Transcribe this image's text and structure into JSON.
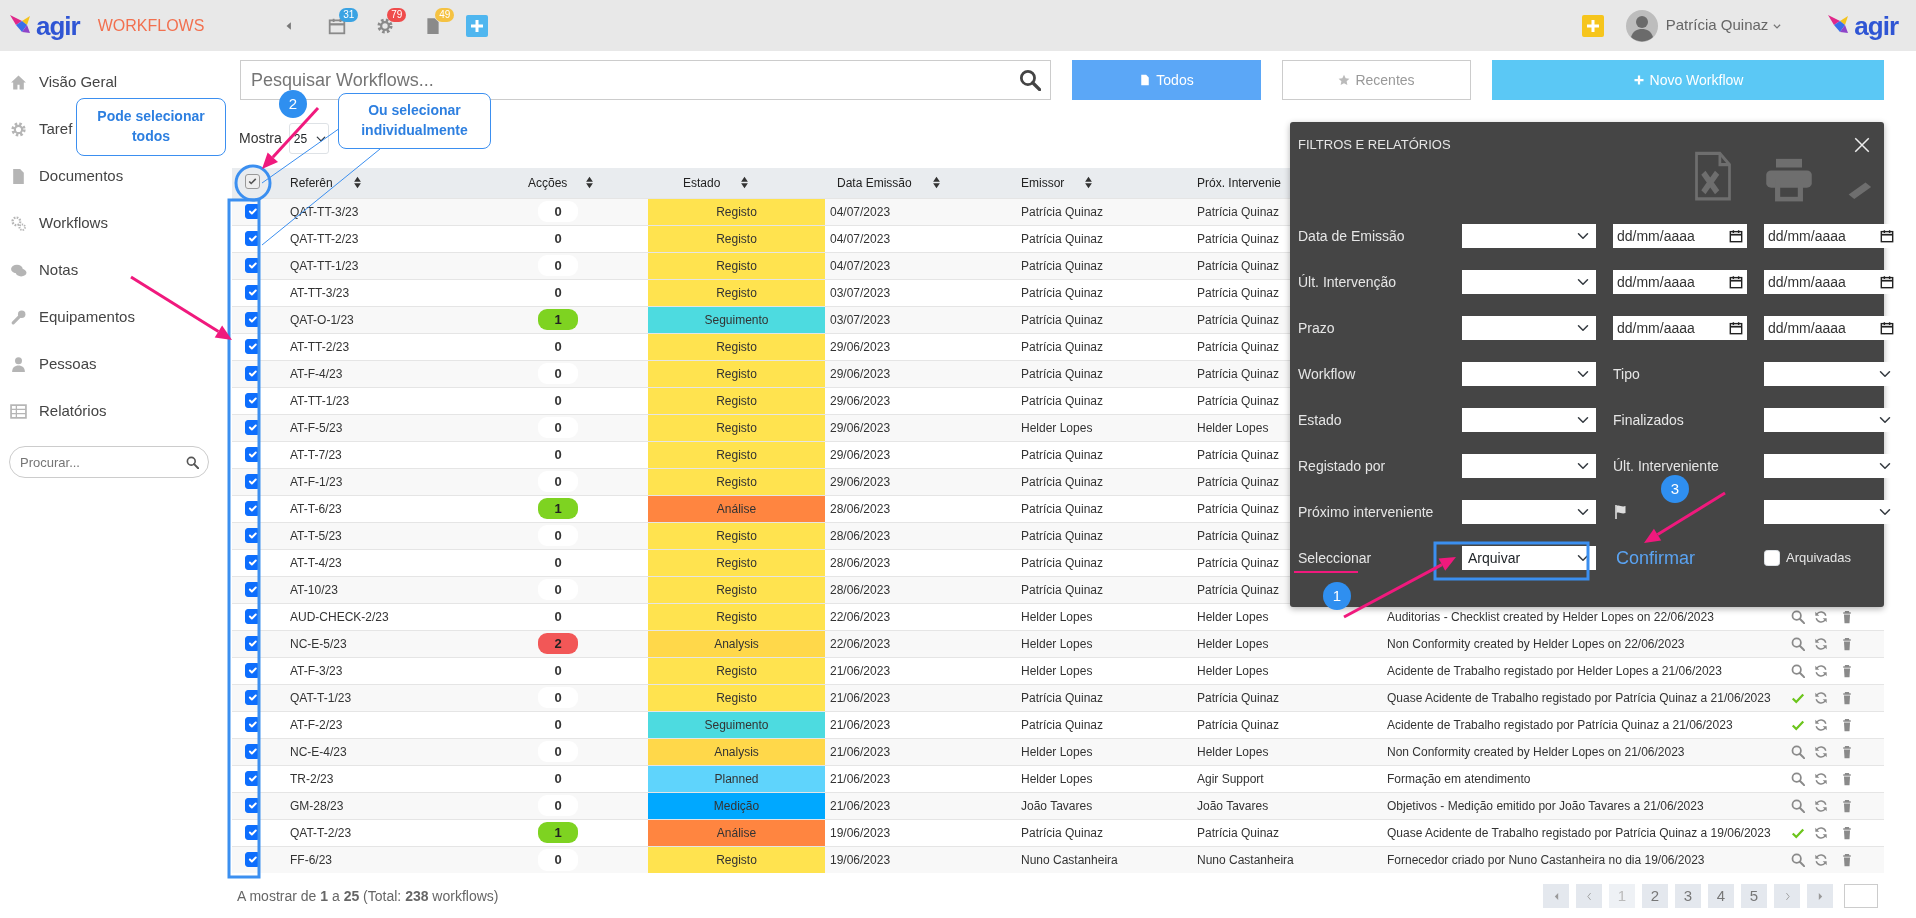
{
  "header": {
    "logo": "agir",
    "module": "WORKFLOWS",
    "notifications": [
      {
        "kind": "calendar",
        "count": "31",
        "color": "#3aa3e3"
      },
      {
        "kind": "gear",
        "count": "79",
        "color": "#ef4b4b"
      },
      {
        "kind": "document",
        "count": "49",
        "color": "#f5c242"
      }
    ],
    "user": {
      "name": "Patrícia Quinaz"
    },
    "logo_right": "agir"
  },
  "sidebar": {
    "items": [
      {
        "kind": "home",
        "label": "Visão Geral"
      },
      {
        "kind": "gear",
        "label": "Taref"
      },
      {
        "kind": "document",
        "label": "Documentos"
      },
      {
        "kind": "gears",
        "label": "Workflows"
      },
      {
        "kind": "chat",
        "label": "Notas"
      },
      {
        "kind": "wrench",
        "label": "Equipamentos"
      },
      {
        "kind": "person",
        "label": "Pessoas"
      },
      {
        "kind": "table",
        "label": "Relatórios"
      }
    ],
    "search": {
      "placeholder": "Procurar..."
    }
  },
  "toolbar": {
    "search": {
      "placeholder": "Pesquisar Workflows..."
    },
    "buttons": [
      {
        "kind": "document",
        "label": "Todos",
        "selected": true
      },
      {
        "kind": "star",
        "label": "Recentes",
        "selected": false
      },
      {
        "kind": "new",
        "label": "Novo Workflow"
      }
    ]
  },
  "page_size": {
    "label": "Mostra",
    "value": "25"
  },
  "table": {
    "select_all": {
      "checked": true
    },
    "columns": [
      {
        "label": "Referên",
        "sortable": true
      },
      {
        "label": "Acções",
        "sortable": true
      },
      {
        "label": "Estado",
        "sortable": true
      },
      {
        "label": "Data Emissão",
        "sortable": true
      },
      {
        "label": "Emissor",
        "sortable": true
      },
      {
        "label": "Próx. Intervenie",
        "sortable": false
      }
    ],
    "rows": [
      {
        "checked": true,
        "reference": "QAT-TT-3/23",
        "actions": {
          "count": "0"
        },
        "state": {
          "label": "Registo",
          "color": "#ffe34f"
        },
        "date": "04/07/2023",
        "issuer": "Patrícia Quinaz",
        "next": "Patrícia Quinaz"
      },
      {
        "checked": true,
        "reference": "QAT-TT-2/23",
        "actions": {
          "count": "0"
        },
        "state": {
          "label": "Registo",
          "color": "#ffe34f"
        },
        "date": "04/07/2023",
        "issuer": "Patrícia Quinaz",
        "next": "Patrícia Quinaz"
      },
      {
        "checked": true,
        "reference": "QAT-TT-1/23",
        "actions": {
          "count": "0"
        },
        "state": {
          "label": "Registo",
          "color": "#ffe34f"
        },
        "date": "04/07/2023",
        "issuer": "Patrícia Quinaz",
        "next": "Patrícia Quinaz"
      },
      {
        "checked": true,
        "reference": "AT-TT-3/23",
        "actions": {
          "count": "0"
        },
        "state": {
          "label": "Registo",
          "color": "#ffe34f"
        },
        "date": "03/07/2023",
        "issuer": "Patrícia Quinaz",
        "next": "Patrícia Quinaz"
      },
      {
        "checked": true,
        "reference": "QAT-O-1/23",
        "actions": {
          "count": "1",
          "color": "#7ed321"
        },
        "state": {
          "label": "Seguimento",
          "color": "#4ddbe0"
        },
        "date": "03/07/2023",
        "issuer": "Patrícia Quinaz",
        "next": "Patrícia Quinaz"
      },
      {
        "checked": true,
        "reference": "AT-TT-2/23",
        "actions": {
          "count": "0"
        },
        "state": {
          "label": "Registo",
          "color": "#ffe34f"
        },
        "date": "29/06/2023",
        "issuer": "Patrícia Quinaz",
        "next": "Patrícia Quinaz"
      },
      {
        "checked": true,
        "reference": "AT-F-4/23",
        "actions": {
          "count": "0"
        },
        "state": {
          "label": "Registo",
          "color": "#ffe34f"
        },
        "date": "29/06/2023",
        "issuer": "Patrícia Quinaz",
        "next": "Patrícia Quinaz"
      },
      {
        "checked": true,
        "reference": "AT-TT-1/23",
        "actions": {
          "count": "0"
        },
        "state": {
          "label": "Registo",
          "color": "#ffe34f"
        },
        "date": "29/06/2023",
        "issuer": "Patrícia Quinaz",
        "next": "Patrícia Quinaz"
      },
      {
        "checked": true,
        "reference": "AT-F-5/23",
        "actions": {
          "count": "0"
        },
        "state": {
          "label": "Registo",
          "color": "#ffe34f"
        },
        "date": "29/06/2023",
        "issuer": "Helder Lopes",
        "next": "Helder Lopes"
      },
      {
        "checked": true,
        "reference": "AT-T-7/23",
        "actions": {
          "count": "0"
        },
        "state": {
          "label": "Registo",
          "color": "#ffe34f"
        },
        "date": "29/06/2023",
        "issuer": "Patrícia Quinaz",
        "next": "Patrícia Quinaz"
      },
      {
        "checked": true,
        "reference": "AT-F-1/23",
        "actions": {
          "count": "0"
        },
        "state": {
          "label": "Registo",
          "color": "#ffe34f"
        },
        "date": "29/06/2023",
        "issuer": "Patrícia Quinaz",
        "next": "Patrícia Quinaz"
      },
      {
        "checked": true,
        "reference": "AT-T-6/23",
        "actions": {
          "count": "1",
          "color": "#7ed321"
        },
        "state": {
          "label": "Análise",
          "color": "#ff8540"
        },
        "date": "28/06/2023",
        "issuer": "Patrícia Quinaz",
        "next": "Patrícia Quinaz"
      },
      {
        "checked": true,
        "reference": "AT-T-5/23",
        "actions": {
          "count": "0"
        },
        "state": {
          "label": "Registo",
          "color": "#ffe34f"
        },
        "date": "28/06/2023",
        "issuer": "Patrícia Quinaz",
        "next": "Patrícia Quinaz"
      },
      {
        "checked": true,
        "reference": "AT-T-4/23",
        "actions": {
          "count": "0"
        },
        "state": {
          "label": "Registo",
          "color": "#ffe34f"
        },
        "date": "28/06/2023",
        "issuer": "Patrícia Quinaz",
        "next": "Patrícia Quinaz"
      },
      {
        "checked": true,
        "reference": "AT-10/23",
        "actions": {
          "count": "0"
        },
        "state": {
          "label": "Registo",
          "color": "#ffe34f"
        },
        "date": "28/06/2023",
        "issuer": "Patrícia Quinaz",
        "next": "Patrícia Quinaz"
      },
      {
        "checked": true,
        "reference": "AUD-CHECK-2/23",
        "actions": {
          "count": "0"
        },
        "state": {
          "label": "Registo",
          "color": "#ffe34f"
        },
        "date": "22/06/2023",
        "issuer": "Helder Lopes",
        "next": "Helder Lopes",
        "title": "Auditorias - Checklist created by Helder Lopes on 22/06/2023",
        "done": false
      },
      {
        "checked": true,
        "reference": "NC-E-5/23",
        "actions": {
          "count": "2",
          "color": "#f25757"
        },
        "state": {
          "label": "Analysis",
          "color": "#ffd84a"
        },
        "date": "22/06/2023",
        "issuer": "Helder Lopes",
        "next": "Helder Lopes",
        "title": "Non Conformity created by Helder Lopes on 22/06/2023",
        "done": false
      },
      {
        "checked": true,
        "reference": "AT-F-3/23",
        "actions": {
          "count": "0"
        },
        "state": {
          "label": "Registo",
          "color": "#ffe34f"
        },
        "date": "21/06/2023",
        "issuer": "Helder Lopes",
        "next": "Helder Lopes",
        "title": "Acidente de Trabalho registado por Helder Lopes a 21/06/2023",
        "done": false
      },
      {
        "checked": true,
        "reference": "QAT-T-1/23",
        "actions": {
          "count": "0"
        },
        "state": {
          "label": "Registo",
          "color": "#ffe34f"
        },
        "date": "21/06/2023",
        "issuer": "Patrícia Quinaz",
        "next": "Patrícia Quinaz",
        "title": "Quase Acidente de Trabalho registado por Patrícia Quinaz a 21/06/2023",
        "done": true
      },
      {
        "checked": true,
        "reference": "AT-F-2/23",
        "actions": {
          "count": "0"
        },
        "state": {
          "label": "Seguimento",
          "color": "#4ddbe0"
        },
        "date": "21/06/2023",
        "issuer": "Patrícia Quinaz",
        "next": "Patrícia Quinaz",
        "title": "Acidente de Trabalho registado por Patrícia Quinaz a 21/06/2023",
        "done": true
      },
      {
        "checked": true,
        "reference": "NC-E-4/23",
        "actions": {
          "count": "0"
        },
        "state": {
          "label": "Analysis",
          "color": "#ffd84a"
        },
        "date": "21/06/2023",
        "issuer": "Helder Lopes",
        "next": "Helder Lopes",
        "title": "Non Conformity created by Helder Lopes on 21/06/2023",
        "done": false
      },
      {
        "checked": true,
        "reference": "TR-2/23",
        "actions": {
          "count": "0"
        },
        "state": {
          "label": "Planned",
          "color": "#5fd4fc"
        },
        "date": "21/06/2023",
        "issuer": "Helder Lopes",
        "next": "Agir Support",
        "title": "Formação em atendimento",
        "done": false
      },
      {
        "checked": true,
        "reference": "GM-28/23",
        "actions": {
          "count": "0"
        },
        "state": {
          "label": "Medição",
          "color": "#00a8ff"
        },
        "date": "21/06/2023",
        "issuer": "João Tavares",
        "next": "João Tavares",
        "title": "Objetivos - Medição emitido por João Tavares a 21/06/2023",
        "done": false
      },
      {
        "checked": true,
        "reference": "QAT-T-2/23",
        "actions": {
          "count": "1",
          "color": "#7ed321"
        },
        "state": {
          "label": "Análise",
          "color": "#ff8540"
        },
        "date": "19/06/2023",
        "issuer": "Patrícia Quinaz",
        "next": "Patrícia Quinaz",
        "title": "Quase Acidente de Trabalho registado por Patrícia Quinaz a 19/06/2023",
        "done": true
      },
      {
        "checked": true,
        "reference": "FF-6/23",
        "actions": {
          "count": "0"
        },
        "state": {
          "label": "Registo",
          "color": "#ffe34f"
        },
        "date": "19/06/2023",
        "issuer": "Nuno Castanheira",
        "next": "Nuno Castanheira",
        "title": "Fornecedor criado por Nuno Castanheira no dia 19/06/2023",
        "done": false
      }
    ]
  },
  "footer": {
    "summary": "A mostrar de **1** a **25** (Total: **238** workflows)",
    "pages": [
      {
        "kind": "first"
      },
      {
        "kind": "prev"
      },
      {
        "kind": "page",
        "label": "1",
        "selected": true
      },
      {
        "kind": "page",
        "label": "2",
        "selected": false
      },
      {
        "kind": "page",
        "label": "3",
        "selected": false
      },
      {
        "kind": "page",
        "label": "4",
        "selected": false
      },
      {
        "kind": "page",
        "label": "5",
        "selected": false
      },
      {
        "kind": "next"
      },
      {
        "kind": "last"
      }
    ]
  },
  "filters": {
    "title": "FILTROS E RELATÓRIOS",
    "rows": [
      {
        "cells": [
          {
            "kind": "label",
            "text": "Data de Emissão"
          },
          {
            "kind": "select"
          },
          {
            "kind": "date",
            "placeholder": "dd/mm/aaaa"
          },
          {
            "kind": "date",
            "placeholder": "dd/mm/aaaa"
          }
        ]
      },
      {
        "cells": [
          {
            "kind": "label",
            "text": "Últ. Intervenção"
          },
          {
            "kind": "select"
          },
          {
            "kind": "date",
            "placeholder": "dd/mm/aaaa"
          },
          {
            "kind": "date",
            "placeholder": "dd/mm/aaaa"
          }
        ]
      },
      {
        "cells": [
          {
            "kind": "label",
            "text": "Prazo"
          },
          {
            "kind": "select"
          },
          {
            "kind": "date",
            "placeholder": "dd/mm/aaaa"
          },
          {
            "kind": "date",
            "placeholder": "dd/mm/aaaa"
          }
        ]
      },
      {
        "cells": [
          {
            "kind": "label",
            "text": "Workflow"
          },
          {
            "kind": "select"
          },
          {
            "kind": "label",
            "text": "Tipo"
          },
          {
            "kind": "select"
          }
        ]
      },
      {
        "cells": [
          {
            "kind": "label",
            "text": "Estado"
          },
          {
            "kind": "select"
          },
          {
            "kind": "label",
            "text": "Finalizados"
          },
          {
            "kind": "select"
          }
        ]
      },
      {
        "cells": [
          {
            "kind": "label",
            "text": "Registado por"
          },
          {
            "kind": "select"
          },
          {
            "kind": "label",
            "text": "Últ. Interveniente"
          },
          {
            "kind": "select"
          }
        ]
      },
      {
        "cells": [
          {
            "kind": "label",
            "text": "Próximo interveniente"
          },
          {
            "kind": "select"
          },
          {
            "kind": "flag"
          },
          {
            "kind": "select"
          }
        ]
      },
      {
        "cells": [
          {
            "kind": "label",
            "text": "Seleccionar"
          },
          {
            "kind": "select",
            "value": "Arquivar"
          },
          {
            "kind": "link",
            "text": "Confirmar"
          },
          {
            "kind": "checkbox",
            "text": "Arquivadas",
            "checked": false
          }
        ]
      }
    ]
  },
  "annotations": {
    "callouts": [
      "Pode selecionar todos",
      "Ou selecionar individualmente"
    ],
    "steps": [
      "1",
      "2",
      "3"
    ]
  }
}
